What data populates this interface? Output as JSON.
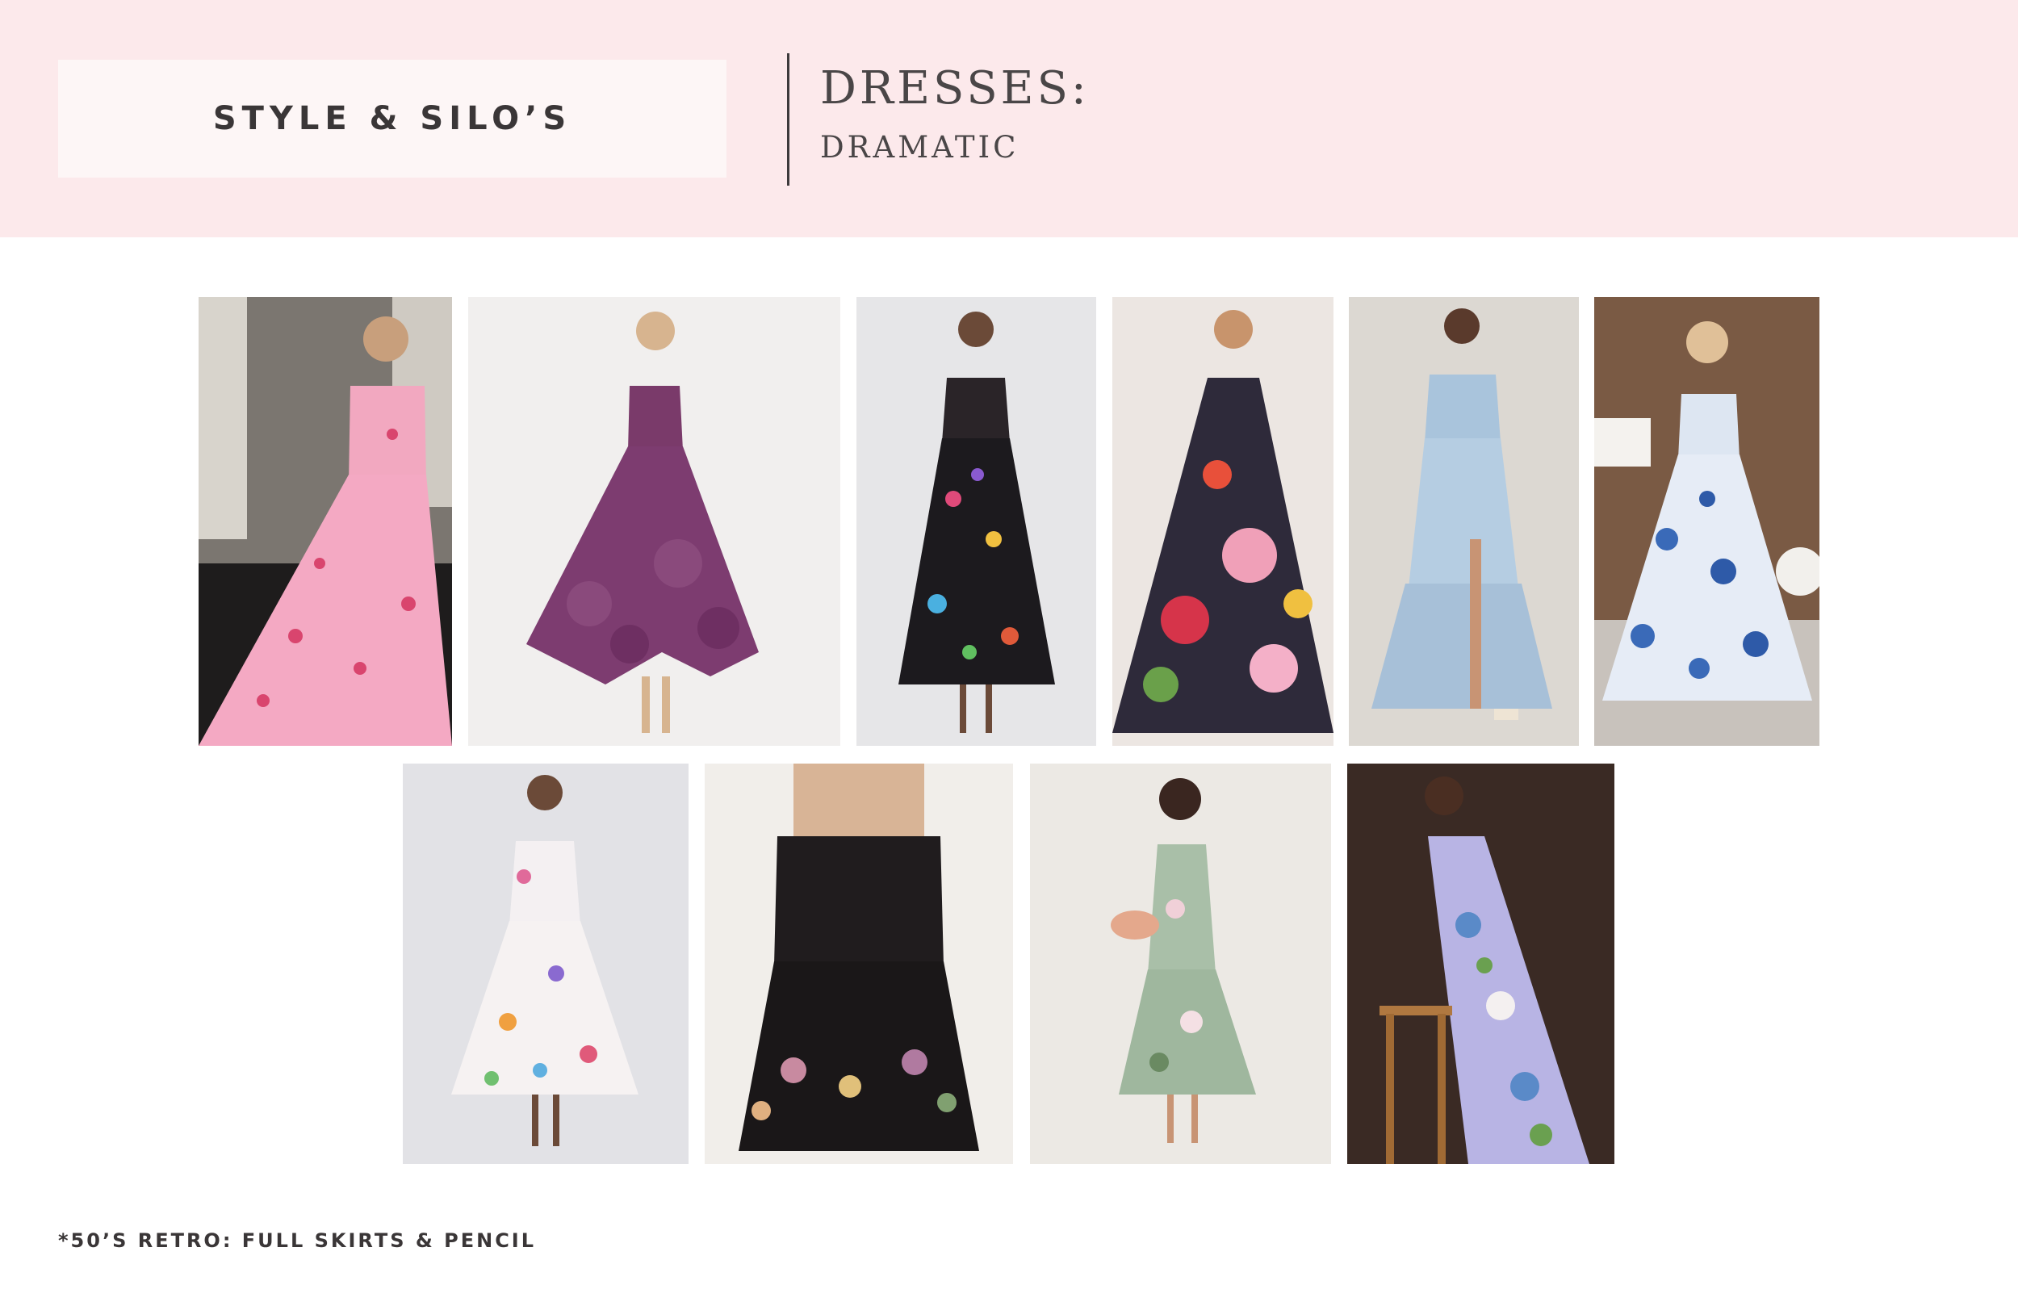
{
  "header": {
    "brand": "STYLE & SILO’S",
    "title": "DRESSES:",
    "subtitle": "DRAMATIC"
  },
  "footnote": "*50’S RETRO: FULL SKIRTS & PENCIL",
  "colors": {
    "header_background": "#fce9eb",
    "brand_box": "#fdf6f6",
    "text": "#3a3637"
  }
}
